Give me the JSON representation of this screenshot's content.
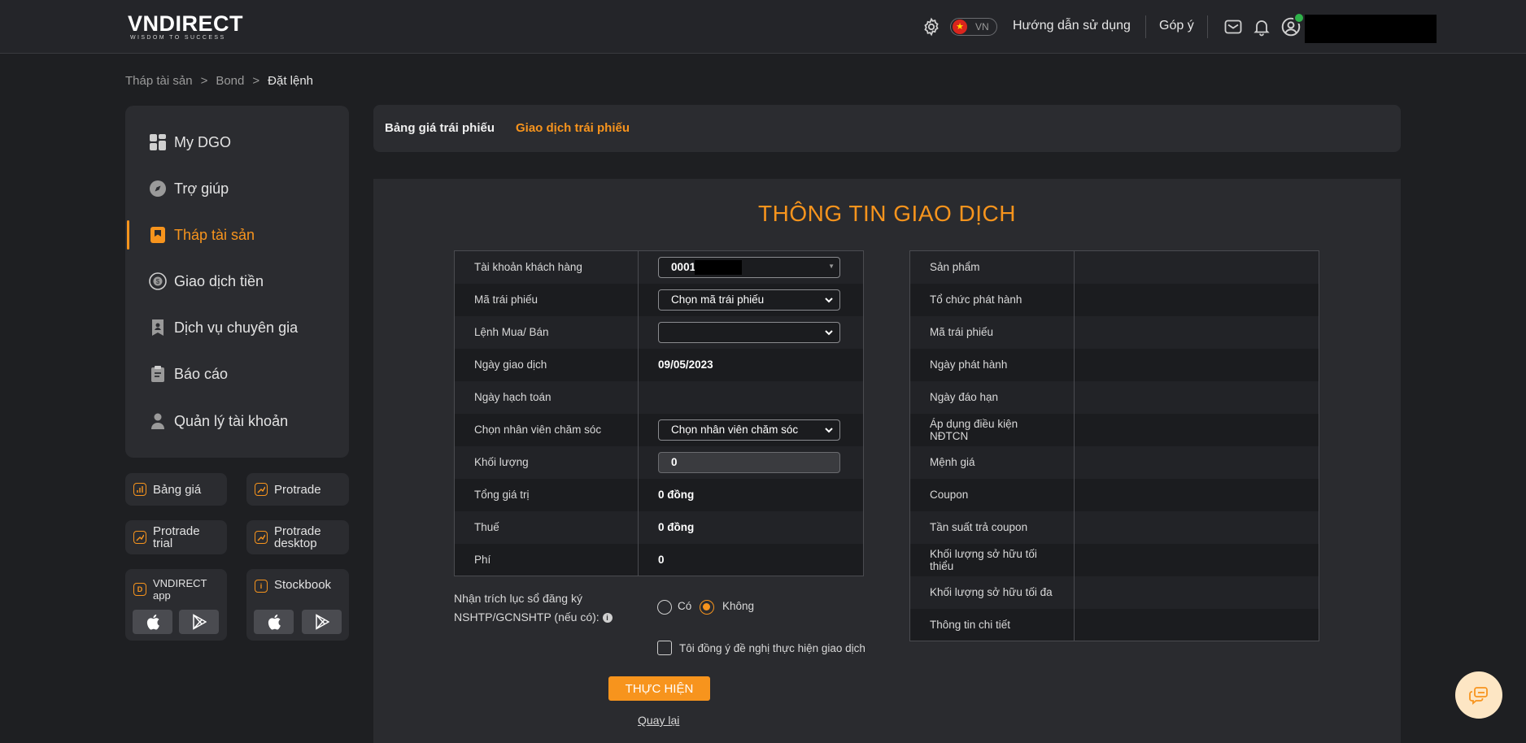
{
  "header": {
    "logo_text": "VNDIRECT",
    "logo_tagline": "WISDOM TO SUCCESS",
    "lang_code": "VN",
    "guide_link": "Hướng dẫn sử dụng",
    "feedback_link": "Góp ý",
    "icons": [
      "gear-icon",
      "vn-flag-icon",
      "mail-icon",
      "bell-icon",
      "user-icon"
    ]
  },
  "breadcrumb": [
    "Tháp tài sản",
    "Bond",
    "Đặt lệnh"
  ],
  "breadcrumb_sep": ">",
  "sidebar": {
    "items": [
      {
        "label": "My DGO",
        "icon": "grid-icon"
      },
      {
        "label": "Trợ giúp",
        "icon": "compass-icon"
      },
      {
        "label": "Tháp tài sản",
        "icon": "bookmark-icon",
        "active": true
      },
      {
        "label": "Giao dịch tiền",
        "icon": "money-cycle-icon"
      },
      {
        "label": "Dịch vụ chuyên gia",
        "icon": "badge-icon"
      },
      {
        "label": "Báo cáo",
        "icon": "clipboard-icon"
      },
      {
        "label": "Quản lý tài khoản",
        "icon": "person-icon"
      }
    ],
    "tiles": [
      {
        "label": "Bảng giá"
      },
      {
        "label": "Protrade"
      },
      {
        "label": "Protrade trial"
      },
      {
        "label": "Protrade desktop"
      },
      {
        "label": "VNDIRECT app"
      },
      {
        "label": "Stockbook"
      }
    ]
  },
  "tabs": [
    {
      "label": "Bảng giá trái phiếu",
      "active": false
    },
    {
      "label": "Giao dịch trái phiếu",
      "active": true
    }
  ],
  "form": {
    "title": "THÔNG TIN GIAO DỊCH",
    "rows": [
      {
        "label": "Tài khoản khách hàng",
        "value": "0001"
      },
      {
        "label": "Mã trái phiếu",
        "value": "Chọn mã trái phiếu"
      },
      {
        "label": "Lệnh Mua/ Bán",
        "value": ""
      },
      {
        "label": "Ngày giao dịch",
        "value": "09/05/2023"
      },
      {
        "label": "Ngày hạch toán",
        "value": ""
      },
      {
        "label": "Chọn nhân viên chăm sóc",
        "value": "Chọn nhân viên chăm sóc"
      },
      {
        "label": "Khối lượng",
        "value": "0"
      },
      {
        "label": "Tổng giá trị",
        "value": "0 đồng"
      },
      {
        "label": "Thuế",
        "value": "0 đồng"
      },
      {
        "label": "Phí",
        "value": "0"
      }
    ],
    "extract_label_line1": "Nhận trích lục sổ đăng ký",
    "extract_label_line2": "NSHTP/GCNSHTP (nếu có):",
    "radio_yes": "Có",
    "radio_no": "Không",
    "radio_selected": "Không",
    "agree_label": "Tôi đồng ý đề nghị thực hiện giao dịch",
    "agree_checked": false,
    "submit_label": "THỰC HIỆN",
    "back_label": "Quay lại"
  },
  "info_table": {
    "rows": [
      {
        "label": "Sản phẩm",
        "value": ""
      },
      {
        "label": "Tổ chức phát hành",
        "value": ""
      },
      {
        "label": "Mã trái phiếu",
        "value": ""
      },
      {
        "label": "Ngày phát hành",
        "value": ""
      },
      {
        "label": "Ngày đáo hạn",
        "value": ""
      },
      {
        "label": "Áp dụng điều kiện NĐTCN",
        "value": ""
      },
      {
        "label": "Mệnh giá",
        "value": ""
      },
      {
        "label": "Coupon",
        "value": ""
      },
      {
        "label": "Tần suất trả coupon",
        "value": ""
      },
      {
        "label": "Khối lượng sở hữu tối thiểu",
        "value": ""
      },
      {
        "label": "Khối lượng sở hữu tối đa",
        "value": ""
      },
      {
        "label": "Thông tin chi tiết",
        "value": ""
      }
    ]
  },
  "colors": {
    "accent": "#f7941d",
    "background": "#1e1f22",
    "panel": "#2b2c30"
  }
}
